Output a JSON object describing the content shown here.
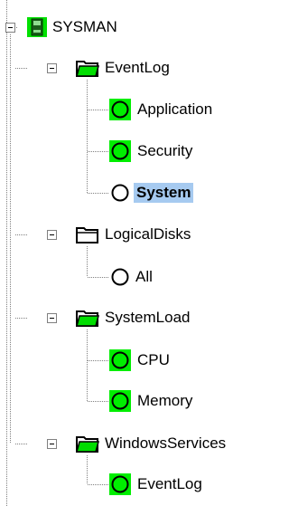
{
  "tree": {
    "root": {
      "label": "SYSMAN",
      "icon": "computer-icon"
    },
    "groups": [
      {
        "label": "EventLog",
        "folder_active": true,
        "items": [
          {
            "label": "Application",
            "status": "ok"
          },
          {
            "label": "Security",
            "status": "ok"
          },
          {
            "label": "System",
            "status": "none",
            "selected": true
          }
        ]
      },
      {
        "label": "LogicalDisks",
        "folder_active": false,
        "items": [
          {
            "label": "All",
            "status": "none"
          }
        ]
      },
      {
        "label": "SystemLoad",
        "folder_active": true,
        "items": [
          {
            "label": "CPU",
            "status": "ok"
          },
          {
            "label": "Memory",
            "status": "ok"
          }
        ]
      },
      {
        "label": "WindowsServices",
        "folder_active": true,
        "items": [
          {
            "label": "EventLog",
            "status": "ok"
          }
        ]
      }
    ]
  },
  "colors": {
    "status_ok": "#00ee00",
    "selection": "#a6caf0",
    "tree_line": "#808080"
  }
}
